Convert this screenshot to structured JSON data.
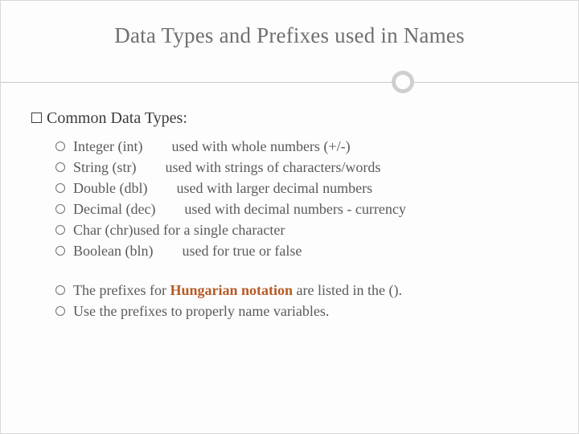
{
  "title": "Data Types and Prefixes used in Names",
  "section_heading": "Common Data Types:",
  "types": [
    {
      "line": "Integer (int)  used with whole numbers (+/-)"
    },
    {
      "line": "String (str)  used with strings of characters/words"
    },
    {
      "line": "Double (dbl)  used with larger decimal numbers"
    },
    {
      "line": "Decimal (dec)  used with decimal numbers - currency"
    },
    {
      "line": "Char (chr)used for a single character"
    },
    {
      "line": "Boolean (bln)  used for true or false"
    }
  ],
  "notes": [
    {
      "pre": "The prefixes for ",
      "accent": "Hungarian notation",
      "post": " are listed in the ()."
    },
    {
      "pre": "Use the prefixes to properly name variables.",
      "accent": "",
      "post": ""
    }
  ]
}
